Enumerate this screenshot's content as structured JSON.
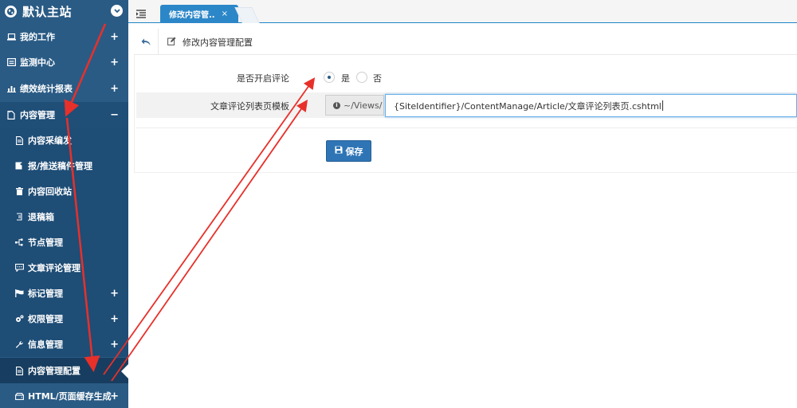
{
  "sidebar": {
    "site_title": "默认主站",
    "items": [
      {
        "label": "我的工作",
        "icon": "laptop-icon",
        "toggle": "+"
      },
      {
        "label": "监测中心",
        "icon": "monitor-icon",
        "toggle": "+"
      },
      {
        "label": "绩效统计报表",
        "icon": "bar-chart-icon",
        "toggle": "+"
      },
      {
        "label": "内容管理",
        "icon": "document-icon",
        "toggle": "−"
      }
    ],
    "sub_items": [
      {
        "label": "内容采编发",
        "icon": "file-text-icon",
        "toggle": ""
      },
      {
        "label": "报/推送稿件管理",
        "icon": "send-doc-icon",
        "toggle": ""
      },
      {
        "label": "内容回收站",
        "icon": "trash-icon",
        "toggle": ""
      },
      {
        "label": "退稿箱",
        "icon": "return-icon",
        "toggle": ""
      },
      {
        "label": "节点管理",
        "icon": "node-icon",
        "toggle": ""
      },
      {
        "label": "文章评论管理",
        "icon": "comment-icon",
        "toggle": ""
      },
      {
        "label": "标记管理",
        "icon": "flag-icon",
        "toggle": "+"
      },
      {
        "label": "权限管理",
        "icon": "cogs-icon",
        "toggle": "+"
      },
      {
        "label": "信息管理",
        "icon": "wrench-icon",
        "toggle": "+"
      },
      {
        "label": "内容管理配置",
        "icon": "file-text-icon",
        "toggle": ""
      },
      {
        "label": "HTML/页面缓存生成",
        "icon": "hdd-icon",
        "toggle": "+"
      }
    ]
  },
  "topbar": {
    "tab_label": "修改内容管..",
    "tab_close": "×"
  },
  "breadcrumb": {
    "title": "修改内容管理配置"
  },
  "form": {
    "comment_label": "是否开启评论",
    "comment_options": [
      {
        "label": "是",
        "checked": true
      },
      {
        "label": "否",
        "checked": false
      }
    ],
    "template_label": "文章评论列表页模板",
    "template_prefix": "~/Views/",
    "template_value": "{SiteIdentifier}/ContentManage/Article/文章评论列表页.cshtml",
    "save_label": "保存"
  },
  "colors": {
    "sidebar": "#2a5b85",
    "accent": "#2c87c8",
    "annotation": "#e8302a"
  }
}
